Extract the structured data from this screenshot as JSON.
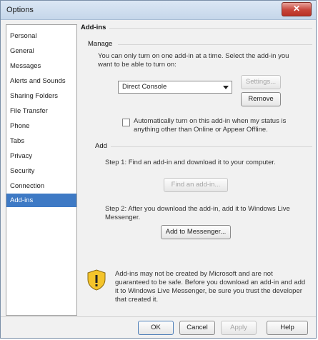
{
  "window": {
    "title": "Options",
    "close_glyph": "✕"
  },
  "sidebar": {
    "selected": "Add-ins",
    "items": [
      {
        "label": "Personal"
      },
      {
        "label": "General"
      },
      {
        "label": "Messages"
      },
      {
        "label": "Alerts and Sounds"
      },
      {
        "label": "Sharing Folders"
      },
      {
        "label": "File Transfer"
      },
      {
        "label": "Phone"
      },
      {
        "label": "Tabs"
      },
      {
        "label": "Privacy"
      },
      {
        "label": "Security"
      },
      {
        "label": "Connection"
      },
      {
        "label": "Add-ins"
      }
    ]
  },
  "content": {
    "heading": "Add-ins",
    "manage": {
      "title": "Manage",
      "description": "You can only turn on one add-in at a time. Select the add-in you want to be able to turn on:",
      "select_value": "Direct Console",
      "settings_label": "Settings...",
      "remove_label": "Remove",
      "auto_checkbox_label": "Automatically turn on this add-in when my status is anything other than Online or Appear Offline."
    },
    "add": {
      "title": "Add",
      "step1": "Step 1: Find an add-in and download it to your computer.",
      "find_label": "Find an add-in...",
      "step2": "Step 2: After you download the add-in, add it to Windows Live Messenger.",
      "add_to_messenger_label": "Add to Messenger..."
    },
    "warning": "Add-ins may not be created by Microsoft and are not guaranteed to be safe. Before you download an add-in and add it to Windows Live Messenger, be sure you trust the developer that created it."
  },
  "footer": {
    "ok_label": "OK",
    "cancel_label": "Cancel",
    "apply_label": "Apply",
    "help_label": "Help"
  },
  "colors": {
    "selected_bg": "#3e7ac5",
    "close_red": "#c7453a",
    "shield_yellow": "#f4c42b"
  }
}
